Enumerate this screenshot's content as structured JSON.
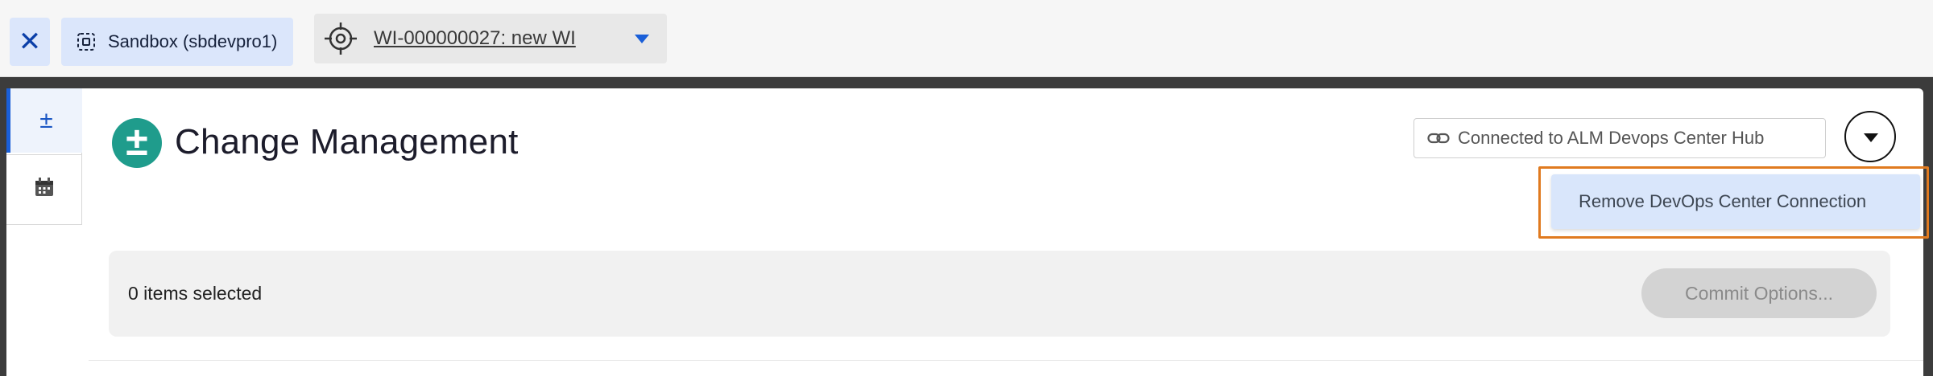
{
  "topbar": {
    "close_label": "✕",
    "sandbox_label": "Sandbox (sbdevpro1)",
    "work_item_label": "WI-000000027: new WI"
  },
  "rail": {
    "items": [
      {
        "icon": "plus-minus-icon",
        "glyph": "±"
      },
      {
        "icon": "calendar-icon"
      }
    ]
  },
  "header": {
    "app_icon_glyph": "±",
    "title": "Change Management",
    "connection_label": "Connected to ALM Devops Center Hub"
  },
  "dropdown": {
    "items": [
      "Remove DevOps Center Connection"
    ]
  },
  "selection": {
    "count_label": "0 items selected",
    "commit_label": "Commit Options..."
  },
  "colors": {
    "accent": "#1a5fd8",
    "app_icon": "#1f9c8c",
    "highlight": "#e07a1f",
    "pill_bg": "#dbe6fb"
  }
}
